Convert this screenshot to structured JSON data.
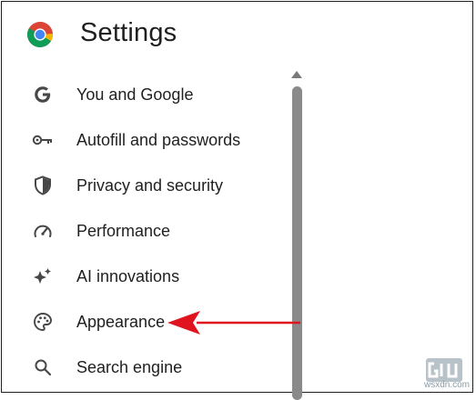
{
  "header": {
    "title": "Settings",
    "logo": "chrome-logo"
  },
  "sidebar": {
    "items": [
      {
        "label": "You and Google",
        "icon": "google-g-icon"
      },
      {
        "label": "Autofill and passwords",
        "icon": "key-icon"
      },
      {
        "label": "Privacy and security",
        "icon": "shield-icon"
      },
      {
        "label": "Performance",
        "icon": "speedometer-icon"
      },
      {
        "label": "AI innovations",
        "icon": "sparkle-icon"
      },
      {
        "label": "Appearance",
        "icon": "palette-icon"
      },
      {
        "label": "Search engine",
        "icon": "search-icon"
      }
    ]
  },
  "annotation": {
    "arrow_color": "#e0141e",
    "target": "Appearance"
  },
  "watermark": {
    "text": "wsxdn.com"
  },
  "colors": {
    "text": "#1f1f1f",
    "icon": "#474747",
    "scrollbar": "#8a8a8a"
  }
}
